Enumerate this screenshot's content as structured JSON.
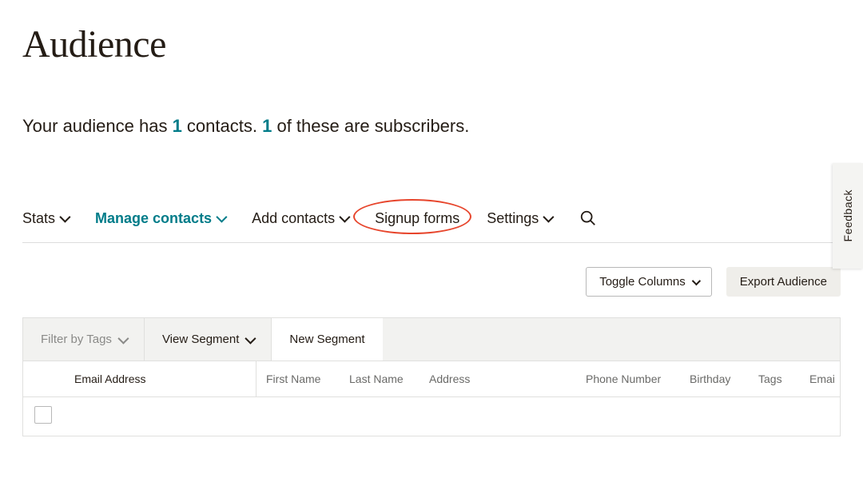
{
  "page": {
    "title": "Audience"
  },
  "summary": {
    "prefix": "Your audience has ",
    "contact_count": "1",
    "mid": " contacts. ",
    "subscriber_count": "1",
    "suffix": " of these are subscribers."
  },
  "tabs": {
    "stats": "Stats",
    "manage_contacts": "Manage contacts",
    "add_contacts": "Add contacts",
    "signup_forms": "Signup forms",
    "settings": "Settings"
  },
  "actions": {
    "toggle_columns": "Toggle Columns",
    "export_audience": "Export Audience"
  },
  "filters": {
    "filter_by_tags": "Filter by Tags",
    "view_segment": "View Segment",
    "new_segment": "New Segment"
  },
  "table": {
    "headers": {
      "email": "Email Address",
      "first_name": "First Name",
      "last_name": "Last Name",
      "address": "Address",
      "phone": "Phone Number",
      "birthday": "Birthday",
      "tags": "Tags",
      "email_trunc": "Emai"
    }
  },
  "feedback": {
    "label": "Feedback"
  }
}
